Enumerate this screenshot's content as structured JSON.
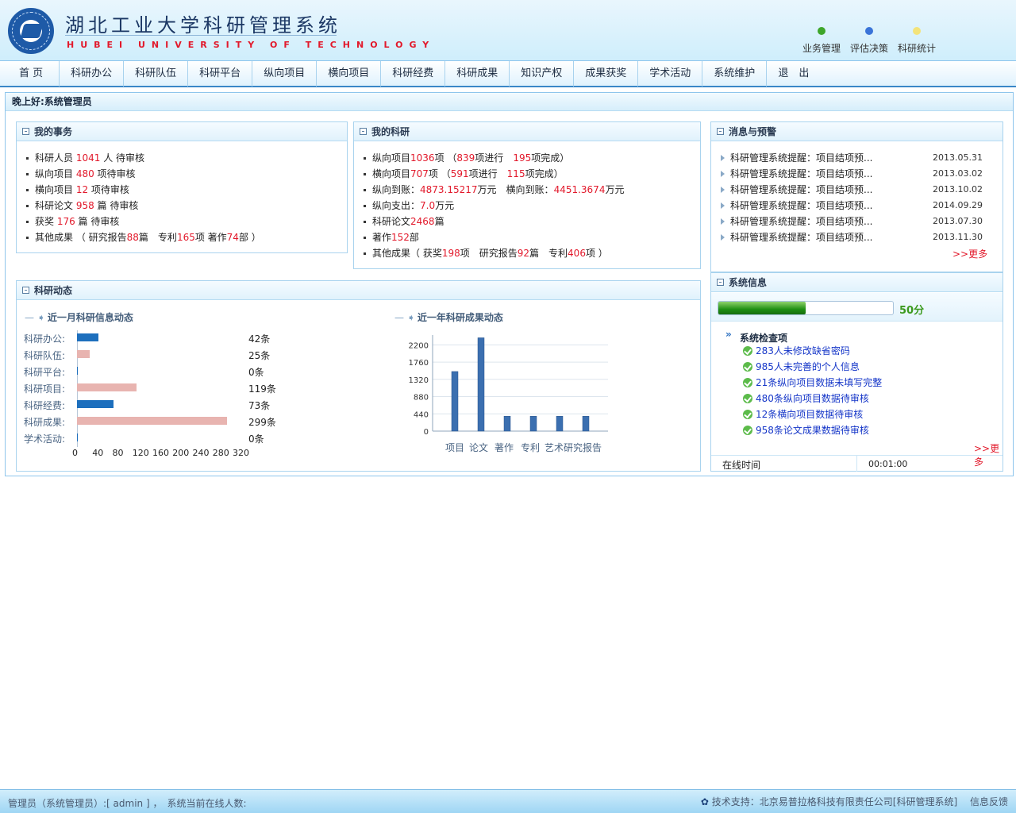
{
  "header": {
    "title_cn": "湖北工业大学科研管理系统",
    "title_en": "HUBEI UNIVERSITY OF TECHNOLOGY",
    "quick_links": [
      {
        "label": "业务管理",
        "color": "#3ea62a"
      },
      {
        "label": "评估决策",
        "color": "#3a74d8"
      },
      {
        "label": "科研统计",
        "color": "#f3e37a"
      }
    ]
  },
  "nav": {
    "items": [
      "首 页",
      "科研办公",
      "科研队伍",
      "科研平台",
      "纵向项目",
      "横向项目",
      "科研经费",
      "科研成果",
      "知识产权",
      "成果获奖",
      "学术活动",
      "系统维护",
      "退　出"
    ]
  },
  "greeting": "晚上好:系统管理员",
  "my_affairs": {
    "title": "我的事务",
    "items": [
      {
        "a": "科研人员 ",
        "n": "1041",
        "b": " 人 待审核"
      },
      {
        "a": "纵向项目 ",
        "n": "480",
        "b": " 项待审核"
      },
      {
        "a": "横向项目 ",
        "n": "12",
        "b": " 项待审核"
      },
      {
        "a": "科研论文 ",
        "n": "958",
        "b": " 篇 待审核"
      },
      {
        "a": "获奖 ",
        "n": "176",
        "b": " 篇 待审核"
      }
    ],
    "other": {
      "prefix": "其他成果 （ 研究报告",
      "reports": "88",
      "mid1": "篇　专利",
      "patents": "165",
      "mid2": "项 著作",
      "books": "74",
      "suffix": "部 ）"
    }
  },
  "my_research": {
    "title": "我的科研",
    "vertical": {
      "prefix": "纵向项目",
      "total": "1036",
      "mid1": "项 （",
      "ongoing": "839",
      "mid2": "项进行　",
      "done": "195",
      "suffix": "项完成）"
    },
    "horizontal": {
      "prefix": "横向项目",
      "total": "707",
      "mid1": "项 （",
      "ongoing": "591",
      "mid2": "项进行　",
      "done": "115",
      "suffix": "项完成）"
    },
    "funds": {
      "p1": "纵向到账：",
      "v1": "4873.15217",
      "u1": "万元　横向到账：",
      "v2": "4451.3674",
      "u2": "万元"
    },
    "spend": {
      "p": "纵向支出：",
      "v": "7.0",
      "u": "万元"
    },
    "papers": {
      "p": "科研论文",
      "v": "2468",
      "u": "篇"
    },
    "books": {
      "p": "著作",
      "v": "152",
      "u": "部"
    },
    "other": {
      "p": "其他成果（ 获奖",
      "awards": "198",
      "m1": "项　研究报告",
      "reports": "92",
      "m2": "篇　专利",
      "patents": "406",
      "s": "项 ）"
    }
  },
  "messages": {
    "title": "消息与预警",
    "items": [
      {
        "text": "科研管理系统提醒：项目结项预...",
        "date": "2013.05.31"
      },
      {
        "text": "科研管理系统提醒：项目结项预...",
        "date": "2013.03.02"
      },
      {
        "text": "科研管理系统提醒：项目结项预...",
        "date": "2013.10.02"
      },
      {
        "text": "科研管理系统提醒：项目结项预...",
        "date": "2014.09.29"
      },
      {
        "text": "科研管理系统提醒：项目结项预...",
        "date": "2013.07.30"
      },
      {
        "text": "科研管理系统提醒：项目结项预...",
        "date": "2013.11.30"
      }
    ],
    "more": ">>更多"
  },
  "dynamics": {
    "title": "科研动态",
    "month_title": "近一月科研信息动态",
    "year_title": "近一年科研成果动态"
  },
  "chart_data": [
    {
      "type": "bar",
      "orientation": "horizontal",
      "categories": [
        "科研办公:",
        "科研队伍:",
        "科研平台:",
        "科研项目:",
        "科研经费:",
        "科研成果:",
        "学术活动:"
      ],
      "values": [
        42,
        25,
        0,
        119,
        73,
        299,
        0
      ],
      "value_labels": [
        "42条",
        "25条",
        "0条",
        "119条",
        "73条",
        "299条",
        "0条"
      ],
      "colors": [
        "#1d6fbd",
        "#e8b4b0",
        "#1d6fbd",
        "#e8b4b0",
        "#1d6fbd",
        "#e8b4b0",
        "#1d6fbd"
      ],
      "xticks": [
        "0",
        "40",
        "80",
        "120",
        "160",
        "200",
        "240",
        "280",
        "320"
      ],
      "xlim": [
        0,
        320
      ]
    },
    {
      "type": "bar",
      "categories": [
        "项目",
        "论文",
        "著作",
        "专利",
        "艺术",
        "研究报告"
      ],
      "values": [
        1520,
        2380,
        380,
        380,
        380,
        380
      ],
      "yticks": [
        "0",
        "440",
        "880",
        "1320",
        "1760",
        "2200"
      ],
      "ylim": [
        0,
        2450
      ],
      "color": "#3b6fb0"
    }
  ],
  "sysinfo": {
    "title": "系统信息",
    "score_label": "50分",
    "score_fraction": 0.5,
    "check_title": "系统检查项",
    "checks": [
      "283人未修改缺省密码",
      "985人未完善的个人信息",
      "21条纵向项目数据未填写完整",
      "480条纵向项目数据待审核",
      "12条横向项目数据待审核",
      "958条论文成果数据待审核"
    ],
    "more": ">>更多",
    "online_label": "在线时间",
    "online_value": "00:01:00"
  },
  "footer": {
    "left": "管理员（系统管理员）:[ admin ] ，　系统当前在线人数:",
    "support": "技术支持：北京易普拉格科技有限责任公司[科研管理系统]",
    "feedback": "信息反馈"
  }
}
